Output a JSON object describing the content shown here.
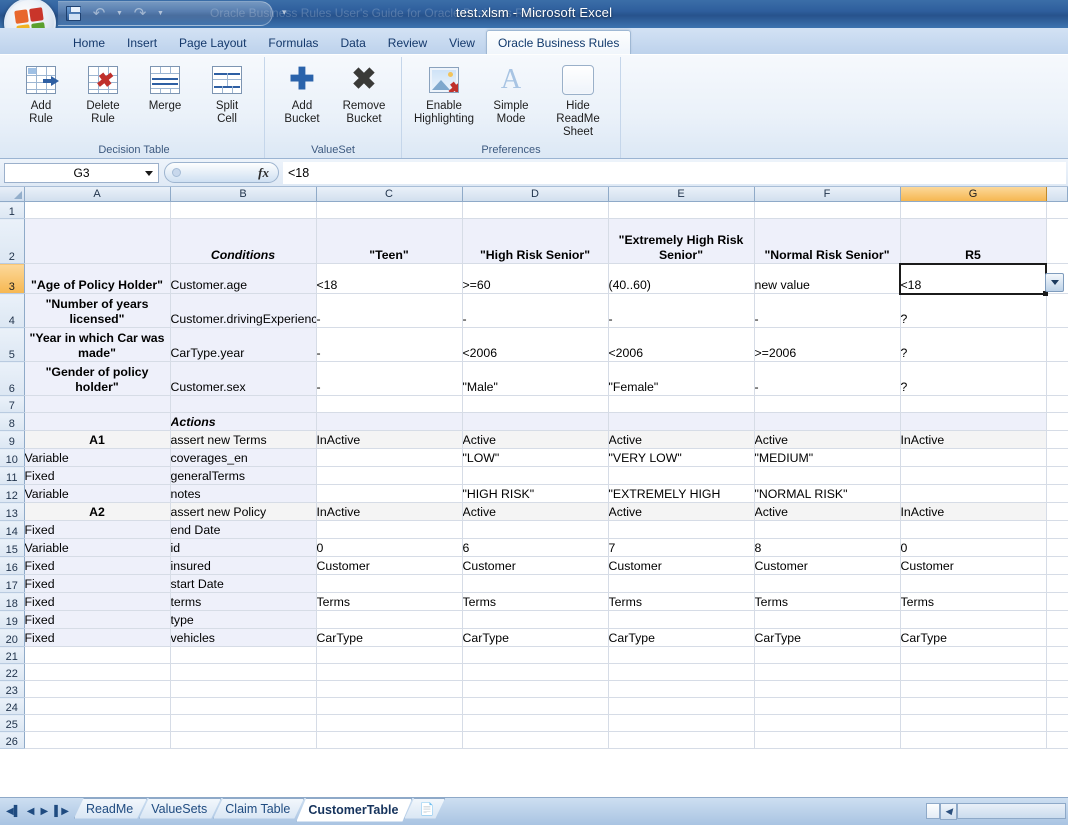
{
  "window": {
    "title": "test.xlsm - Microsoft Excel",
    "ghost_title": "Oracle Business Rules User's Guide for Oracle Business Rules",
    "quick_access": {
      "save": "save-icon",
      "undo": "undo-icon",
      "redo": "redo-icon",
      "customize": "customize-icon"
    }
  },
  "ribbon": {
    "tabs": [
      {
        "label": "Home",
        "active": false
      },
      {
        "label": "Insert",
        "active": false
      },
      {
        "label": "Page Layout",
        "active": false
      },
      {
        "label": "Formulas",
        "active": false
      },
      {
        "label": "Data",
        "active": false
      },
      {
        "label": "Review",
        "active": false
      },
      {
        "label": "View",
        "active": false
      },
      {
        "label": "Oracle Business Rules",
        "active": true
      }
    ],
    "groups": [
      {
        "label": "Decision Table",
        "buttons": [
          {
            "label": "Add\nRule",
            "icon": "add-rule-icon"
          },
          {
            "label": "Delete\nRule",
            "icon": "delete-rule-icon"
          },
          {
            "label": "Merge",
            "icon": "merge-icon"
          },
          {
            "label": "Split\nCell",
            "icon": "split-cell-icon"
          }
        ]
      },
      {
        "label": "ValueSet",
        "buttons": [
          {
            "label": "Add\nBucket",
            "icon": "add-bucket-icon"
          },
          {
            "label": "Remove\nBucket",
            "icon": "remove-bucket-icon"
          }
        ]
      },
      {
        "label": "Preferences",
        "buttons": [
          {
            "label": "Enable\nHighlighting",
            "icon": "enable-highlighting-icon"
          },
          {
            "label": "Simple\nMode",
            "icon": "simple-mode-icon"
          },
          {
            "label": "Hide ReadMe\nSheet",
            "icon": "hide-readme-icon"
          }
        ]
      }
    ]
  },
  "formula_bar": {
    "name_box": "G3",
    "fx_label": "fx",
    "formula": "<18"
  },
  "grid": {
    "columns": [
      "A",
      "B",
      "C",
      "D",
      "E",
      "F",
      "G"
    ],
    "selected_column": "G",
    "selected_row": 3,
    "selected_cell": "G3",
    "rows": [
      {
        "n": 1,
        "cells": [
          "",
          "",
          "",
          "",
          "",
          "",
          ""
        ]
      },
      {
        "n": 2,
        "cells": [
          "",
          "Conditions",
          "\"Teen\"",
          "\"High Risk Senior\"",
          "\"Extremely High Risk Senior\"",
          "\"Normal Risk Senior\"",
          "R5"
        ]
      },
      {
        "n": 3,
        "cells": [
          "\"Age of Policy Holder\"",
          "Customer.age",
          "<18",
          ">=60",
          "(40..60)",
          "new value",
          "<18"
        ]
      },
      {
        "n": 4,
        "cells": [
          "\"Number of years licensed\"",
          "Customer.drivingExperience",
          "-",
          "-",
          "-",
          "-",
          "?"
        ]
      },
      {
        "n": 5,
        "cells": [
          "\"Year in which Car was made\"",
          "CarType.year",
          "-",
          "<2006",
          "<2006",
          ">=2006",
          "?"
        ]
      },
      {
        "n": 6,
        "cells": [
          "\"Gender of policy holder\"",
          "Customer.sex",
          "-",
          "\"Male\"",
          "\"Female\"",
          "-",
          "?"
        ]
      },
      {
        "n": 7,
        "cells": [
          "",
          "",
          "",
          "",
          "",
          "",
          ""
        ]
      },
      {
        "n": 8,
        "cells": [
          "",
          "Actions",
          "",
          "",
          "",
          "",
          ""
        ]
      },
      {
        "n": 9,
        "cells": [
          "A1",
          "assert new Terms",
          "InActive",
          "Active",
          "Active",
          "Active",
          "InActive"
        ]
      },
      {
        "n": 10,
        "cells": [
          "Variable",
          "coverages_en",
          "",
          "\"LOW\"",
          "\"VERY LOW\"",
          "\"MEDIUM\"",
          ""
        ]
      },
      {
        "n": 11,
        "cells": [
          "Fixed",
          "generalTerms",
          "",
          "",
          "",
          "",
          ""
        ]
      },
      {
        "n": 12,
        "cells": [
          "Variable",
          "notes",
          "",
          "\"HIGH RISK\"",
          "\"EXTREMELY HIGH",
          "\"NORMAL RISK\"",
          ""
        ]
      },
      {
        "n": 13,
        "cells": [
          "A2",
          "assert new Policy",
          "InActive",
          "Active",
          "Active",
          "Active",
          "InActive"
        ]
      },
      {
        "n": 14,
        "cells": [
          "Fixed",
          "end Date",
          "",
          "",
          "",
          "",
          ""
        ]
      },
      {
        "n": 15,
        "cells": [
          "Variable",
          "id",
          "0",
          "6",
          "7",
          "8",
          "0"
        ]
      },
      {
        "n": 16,
        "cells": [
          "Fixed",
          "insured",
          "Customer",
          "Customer",
          "Customer",
          "Customer",
          "Customer"
        ]
      },
      {
        "n": 17,
        "cells": [
          "Fixed",
          "start Date",
          "",
          "",
          "",
          "",
          ""
        ]
      },
      {
        "n": 18,
        "cells": [
          "Fixed",
          "terms",
          "Terms",
          "Terms",
          "Terms",
          "Terms",
          "Terms"
        ]
      },
      {
        "n": 19,
        "cells": [
          "Fixed",
          "type",
          "",
          "",
          "",
          "",
          ""
        ]
      },
      {
        "n": 20,
        "cells": [
          "Fixed",
          "vehicles",
          "CarType",
          "CarType",
          "CarType",
          "CarType",
          "CarType"
        ]
      },
      {
        "n": 21,
        "cells": [
          "",
          "",
          "",
          "",
          "",
          "",
          ""
        ]
      },
      {
        "n": 22,
        "cells": [
          "",
          "",
          "",
          "",
          "",
          "",
          ""
        ]
      },
      {
        "n": 23,
        "cells": [
          "",
          "",
          "",
          "",
          "",
          "",
          ""
        ]
      },
      {
        "n": 24,
        "cells": [
          "",
          "",
          "",
          "",
          "",
          "",
          ""
        ]
      },
      {
        "n": 25,
        "cells": [
          "",
          "",
          "",
          "",
          "",
          "",
          ""
        ]
      },
      {
        "n": 26,
        "cells": [
          "",
          "",
          "",
          "",
          "",
          "",
          ""
        ]
      }
    ]
  },
  "sheet_tabs": {
    "nav": {
      "first": "▮◀",
      "prev": "◀",
      "next": "▶",
      "last": "▶▮"
    },
    "tabs": [
      {
        "label": "ReadMe",
        "active": false
      },
      {
        "label": "ValueSets",
        "active": false
      },
      {
        "label": "Claim Table",
        "active": false
      },
      {
        "label": "CustomerTable",
        "active": true
      }
    ],
    "insert_sheet": "insert-worksheet-icon"
  },
  "colors": {
    "accent": "#2e5e9c",
    "selection_header": "#f6b751",
    "band_lavender": "#eef0fa",
    "band_gray": "#f4f4f4"
  }
}
